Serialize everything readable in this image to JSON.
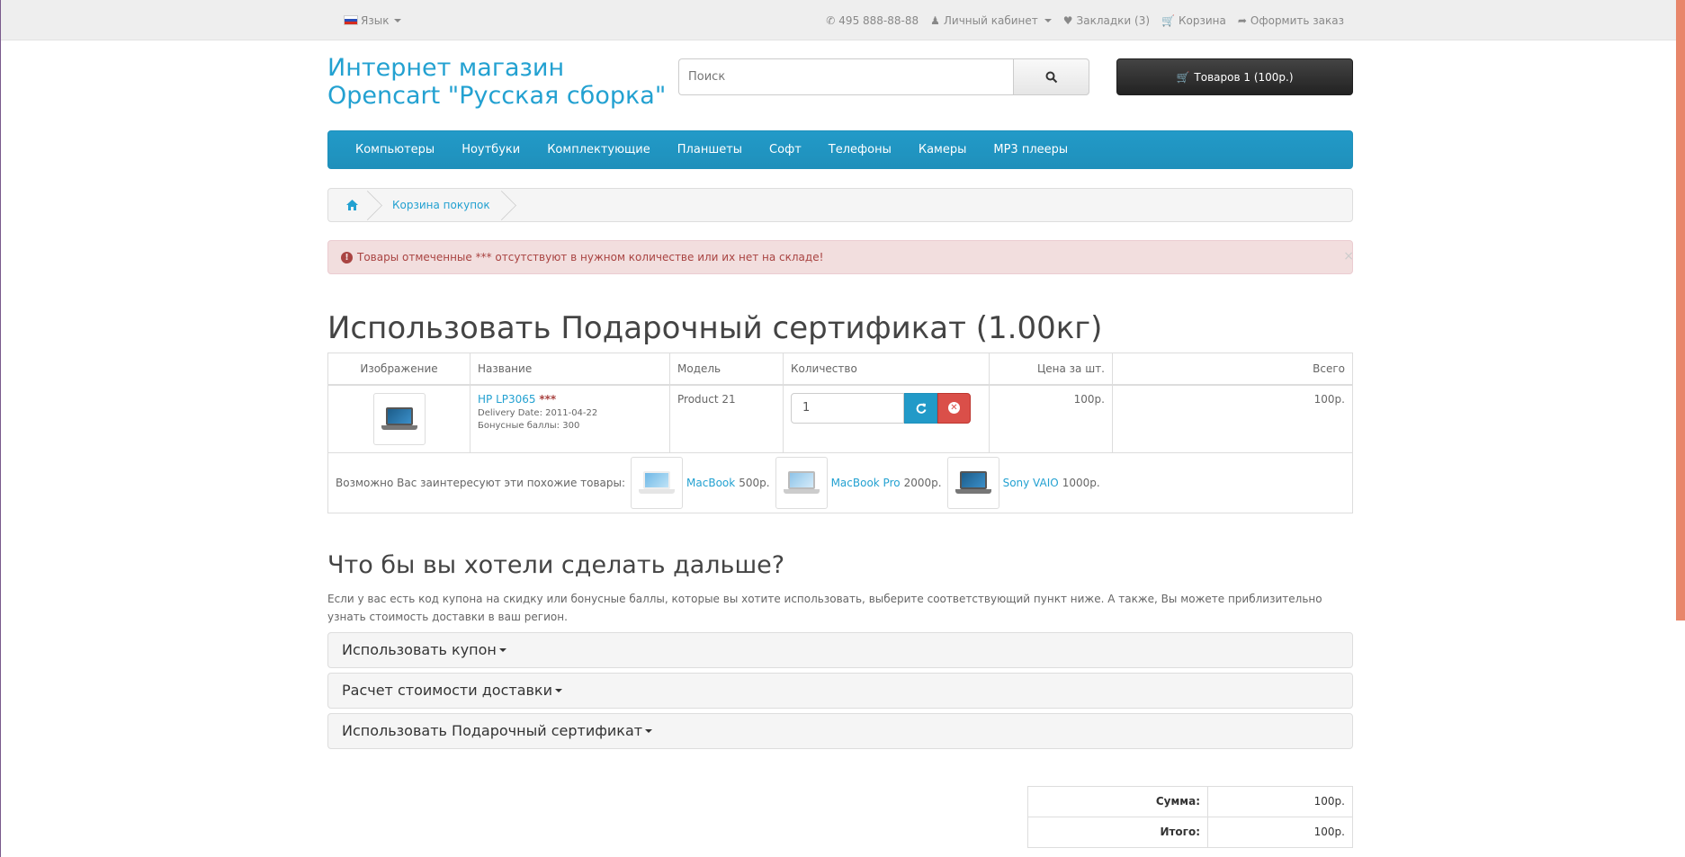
{
  "topbar": {
    "language": "Язык",
    "phone": "495 888-88-88",
    "account": "Личный кабинет",
    "wishlist": "Закладки (3)",
    "cart": "Корзина",
    "checkout": "Оформить заказ"
  },
  "header": {
    "logo_line1": "Интернет магазин",
    "logo_line2": "Opencart \"Русская сборка\"",
    "search_placeholder": "Поиск",
    "cart_button": "Товаров 1 (100р.)"
  },
  "menu": [
    "Компьютеры",
    "Ноутбуки",
    "Комплектующие",
    "Планшеты",
    "Софт",
    "Телефоны",
    "Камеры",
    "MP3 плееры"
  ],
  "breadcrumb": {
    "current": "Корзина покупок"
  },
  "alert": {
    "text": "Товары отмеченные *** отсутствуют в нужном количестве или их нет на складе!",
    "close": "×"
  },
  "page_title": "Использовать Подарочный сертификат  (1.00кг)",
  "cart_table": {
    "headers": [
      "Изображение",
      "Название",
      "Модель",
      "Количество",
      "Цена за шт.",
      "Всего"
    ],
    "rows": [
      {
        "name": "HP LP3065",
        "stock_mark": "***",
        "delivery": "Delivery Date: 2011-04-22",
        "bonus": "Бонусные баллы: 300",
        "model": "Product 21",
        "quantity": "1",
        "unit_price": "100р.",
        "total": "100р."
      }
    ],
    "related_label": "Возможно Вас заинтересуют эти похожие товары:",
    "related": [
      {
        "name": "MacBook",
        "price": "500р."
      },
      {
        "name": "MacBook Pro",
        "price": "2000р."
      },
      {
        "name": "Sony VAIO",
        "price": "1000р."
      }
    ]
  },
  "next": {
    "title": "Что бы вы хотели сделать дальше?",
    "description": "Если у вас есть код купона на скидку или бонусные баллы, которые вы хотите использовать, выберите соответствующий пункт ниже. А также, Вы можете приблизительно узнать стоимость доставки в ваш регион.",
    "panels": [
      "Использовать купон",
      "Расчет стоимости доставки",
      "Использовать Подарочный сертификат"
    ]
  },
  "totals": [
    {
      "label": "Сумма:",
      "value": "100р."
    },
    {
      "label": "Итого:",
      "value": "100р."
    }
  ],
  "colors": {
    "accent": "#23a1d1",
    "menu": "#229ac8",
    "alert_bg": "#f2dede",
    "alert_text": "#a94442",
    "scroll_thumb": "#e8866a"
  }
}
